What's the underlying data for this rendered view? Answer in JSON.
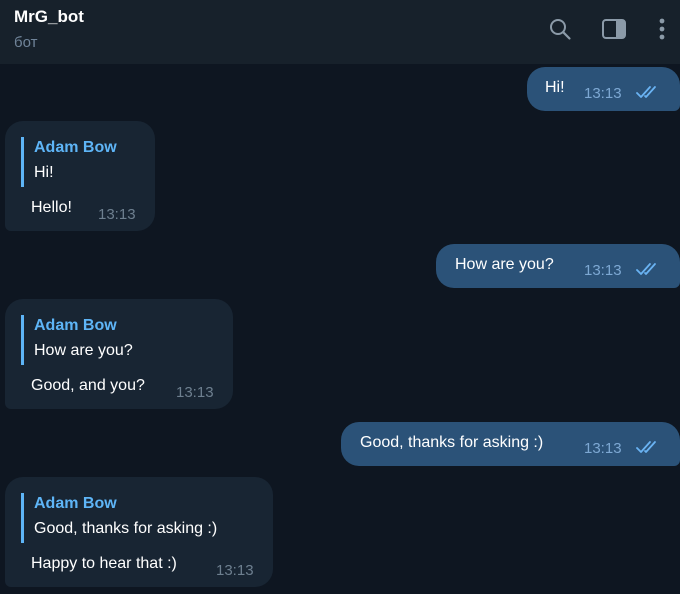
{
  "header": {
    "title": "MrG_bot",
    "subtitle": "бот",
    "icons": [
      "search-icon",
      "sidebar-toggle-icon",
      "more-vertical-icon"
    ]
  },
  "colors": {
    "header_bg": "#17212b",
    "chat_bg": "#0e1621",
    "outgoing_bubble": "#2b5278",
    "incoming_bubble": "#182533",
    "accent": "#5eb5f7"
  },
  "messages": [
    {
      "direction": "out",
      "text": "Hi!",
      "time": "13:13",
      "status": "read"
    },
    {
      "direction": "in",
      "reply_author": "Adam Bow",
      "reply_text": "Hi!",
      "text": "Hello!",
      "time": "13:13"
    },
    {
      "direction": "out",
      "text": "How are you?",
      "time": "13:13",
      "status": "read"
    },
    {
      "direction": "in",
      "reply_author": "Adam Bow",
      "reply_text": "How are you?",
      "text": "Good, and you?",
      "time": "13:13"
    },
    {
      "direction": "out",
      "text": "Good, thanks for asking :)",
      "time": "13:13",
      "status": "read"
    },
    {
      "direction": "in",
      "reply_author": "Adam Bow",
      "reply_text": "Good, thanks for asking :)",
      "text": "Happy to hear that :)",
      "time": "13:13"
    }
  ]
}
